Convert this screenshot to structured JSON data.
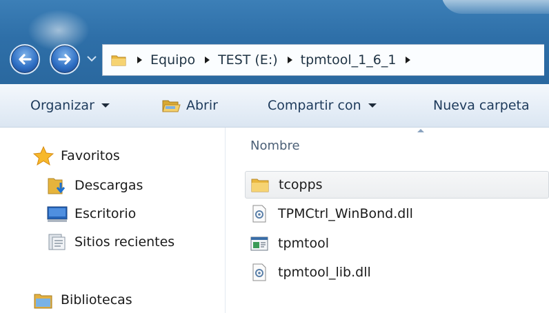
{
  "breadcrumb": {
    "items": [
      "Equipo",
      "TEST (E:)",
      "tpmtool_1_6_1"
    ]
  },
  "toolbar": {
    "organize_label": "Organizar",
    "open_label": "Abrir",
    "share_label": "Compartir con",
    "new_folder_label": "Nueva carpeta"
  },
  "navpane": {
    "favorites_label": "Favoritos",
    "downloads_label": "Descargas",
    "desktop_label": "Escritorio",
    "recent_label": "Sitios recientes",
    "libraries_label": "Bibliotecas"
  },
  "content": {
    "column_name": "Nombre",
    "files": [
      {
        "name": "tcopps",
        "icon": "folder-icon"
      },
      {
        "name": "TPMCtrl_WinBond.dll",
        "icon": "dll-file-icon"
      },
      {
        "name": "tpmtool",
        "icon": "application-icon"
      },
      {
        "name": "tpmtool_lib.dll",
        "icon": "dll-file-icon"
      }
    ]
  },
  "colors": {
    "titlebar": "#2e6fa8",
    "toolbar": "#e6eef7",
    "selection": "#eceef0",
    "toolbar_text": "#1d3a5b",
    "folder": "#f2c14a"
  }
}
